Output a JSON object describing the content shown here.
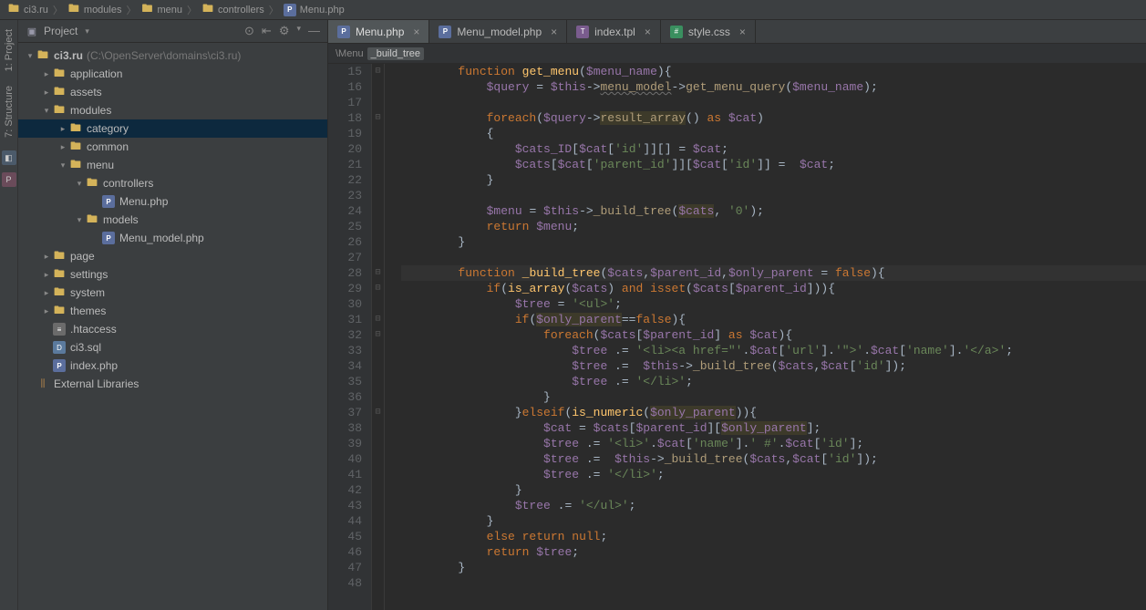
{
  "breadcrumb": [
    {
      "icon": "folder",
      "label": "ci3.ru"
    },
    {
      "icon": "folder",
      "label": "modules"
    },
    {
      "icon": "folder",
      "label": "menu"
    },
    {
      "icon": "folder",
      "label": "controllers"
    },
    {
      "icon": "php",
      "label": "Menu.php"
    }
  ],
  "leftTools": {
    "project": "1: Project",
    "structure": "7: Structure"
  },
  "sidebar": {
    "title": "Project",
    "icons": {
      "locate": "⊙",
      "collapse": "⇤",
      "gear": "⚙",
      "dropdown": "▾",
      "hide": "—"
    }
  },
  "tree": [
    {
      "depth": 0,
      "arrow": "▾",
      "icon": "folder",
      "label": "ci3.ru",
      "extra": "(C:\\OpenServer\\domains\\ci3.ru)",
      "bold": true
    },
    {
      "depth": 1,
      "arrow": "▸",
      "icon": "folder",
      "label": "application"
    },
    {
      "depth": 1,
      "arrow": "▸",
      "icon": "folder",
      "label": "assets"
    },
    {
      "depth": 1,
      "arrow": "▾",
      "icon": "folder",
      "label": "modules"
    },
    {
      "depth": 2,
      "arrow": "▸",
      "icon": "folder",
      "label": "category",
      "selected": true
    },
    {
      "depth": 2,
      "arrow": "▸",
      "icon": "folder",
      "label": "common"
    },
    {
      "depth": 2,
      "arrow": "▾",
      "icon": "folder",
      "label": "menu"
    },
    {
      "depth": 3,
      "arrow": "▾",
      "icon": "folder",
      "label": "controllers"
    },
    {
      "depth": 4,
      "arrow": "",
      "icon": "php",
      "label": "Menu.php"
    },
    {
      "depth": 3,
      "arrow": "▾",
      "icon": "folder",
      "label": "models"
    },
    {
      "depth": 4,
      "arrow": "",
      "icon": "php",
      "label": "Menu_model.php"
    },
    {
      "depth": 1,
      "arrow": "▸",
      "icon": "folder",
      "label": "page"
    },
    {
      "depth": 1,
      "arrow": "▸",
      "icon": "folder",
      "label": "settings"
    },
    {
      "depth": 1,
      "arrow": "▸",
      "icon": "folder",
      "label": "system"
    },
    {
      "depth": 1,
      "arrow": "▸",
      "icon": "folder",
      "label": "themes"
    },
    {
      "depth": 1,
      "arrow": "",
      "icon": "txt",
      "label": ".htaccess"
    },
    {
      "depth": 1,
      "arrow": "",
      "icon": "sql",
      "label": "ci3.sql"
    },
    {
      "depth": 1,
      "arrow": "",
      "icon": "php",
      "label": "index.php"
    },
    {
      "depth": 0,
      "arrow": "",
      "icon": "lib",
      "label": "External Libraries"
    }
  ],
  "tabs": [
    {
      "icon": "php",
      "label": "Menu.php",
      "active": true
    },
    {
      "icon": "php",
      "label": "Menu_model.php"
    },
    {
      "icon": "tpl",
      "label": "index.tpl"
    },
    {
      "icon": "css",
      "label": "style.css"
    }
  ],
  "crumbBar": {
    "c1": "\\Menu",
    "c2": "_build_tree"
  },
  "code": {
    "start": 15,
    "lines": [
      {
        "n": 15,
        "html": "        <span class='c-keyword'>function</span> <span class='c-func'>get_menu</span>(<span class='c-var'>$menu_name</span>){"
      },
      {
        "n": 16,
        "html": "            <span class='c-var'>$query</span> = <span class='c-var'>$this</span>-&gt;<span class='c-method c-underline'>menu_model</span>-&gt;<span class='c-method'>get_menu_query</span>(<span class='c-var'>$menu_name</span>);"
      },
      {
        "n": 17,
        "html": ""
      },
      {
        "n": 18,
        "html": "            <span class='c-keyword'>foreach</span>(<span class='c-var'>$query</span>-&gt;<span class='c-method c-warn'>result_array</span>() <span class='c-keyword'>as</span> <span class='c-var'>$cat</span>)"
      },
      {
        "n": 19,
        "html": "            {"
      },
      {
        "n": 20,
        "html": "                <span class='c-var'>$cats_ID</span>[<span class='c-var'>$cat</span>[<span class='c-string'>'id'</span>]][] = <span class='c-var'>$cat</span>;"
      },
      {
        "n": 21,
        "html": "                <span class='c-var'>$cats</span>[<span class='c-var'>$cat</span>[<span class='c-string'>'parent_id'</span>]][<span class='c-var'>$cat</span>[<span class='c-string'>'id'</span>]] =  <span class='c-var'>$cat</span>;"
      },
      {
        "n": 22,
        "html": "            }"
      },
      {
        "n": 23,
        "html": ""
      },
      {
        "n": 24,
        "html": "            <span class='c-var'>$menu</span> = <span class='c-var'>$this</span>-&gt;<span class='c-method'>_build_tree</span>(<span class='c-var c-warn'>$cats</span>, <span class='c-string'>'0'</span>);"
      },
      {
        "n": 25,
        "html": "            <span class='c-keyword'>return</span> <span class='c-var'>$menu</span>;"
      },
      {
        "n": 26,
        "html": "        }"
      },
      {
        "n": 27,
        "html": ""
      },
      {
        "n": 28,
        "html": "        <span class='c-keyword'>function</span> <span class='c-func'>_build_tree</span>(<span class='c-var'>$cats</span>,<span class='c-var'>$parent_id</span>,<span class='c-var'>$only_parent</span> = <span class='c-keyword'>false</span>){",
        "hl": true
      },
      {
        "n": 29,
        "html": "            <span class='c-keyword'>if</span>(<span class='c-func'>is_array</span>(<span class='c-var'>$cats</span>) <span class='c-keyword'>and</span> <span class='c-keyword'>isset</span>(<span class='c-var'>$cats</span>[<span class='c-var'>$parent_id</span>])){"
      },
      {
        "n": 30,
        "html": "                <span class='c-var'>$tree</span> = <span class='c-string'>'&lt;ul&gt;'</span>;"
      },
      {
        "n": 31,
        "html": "                <span class='c-keyword'>if</span>(<span class='c-var c-warn'>$only_parent</span>==<span class='c-keyword'>false</span>){"
      },
      {
        "n": 32,
        "html": "                    <span class='c-keyword'>foreach</span>(<span class='c-var'>$cats</span>[<span class='c-var'>$parent_id</span>] <span class='c-keyword'>as</span> <span class='c-var'>$cat</span>){"
      },
      {
        "n": 33,
        "html": "                        <span class='c-var'>$tree</span> .= <span class='c-string'>'&lt;li&gt;&lt;a href=\"'</span>.<span class='c-var'>$cat</span>[<span class='c-string'>'url'</span>].<span class='c-string'>'\"&gt;'</span>.<span class='c-var'>$cat</span>[<span class='c-string'>'name'</span>].<span class='c-string'>'&lt;/a&gt;'</span>;"
      },
      {
        "n": 34,
        "html": "                        <span class='c-var'>$tree</span> .=  <span class='c-var'>$this</span>-&gt;<span class='c-method'>_build_tree</span>(<span class='c-var'>$cats</span>,<span class='c-var'>$cat</span>[<span class='c-string'>'id'</span>]);"
      },
      {
        "n": 35,
        "html": "                        <span class='c-var'>$tree</span> .= <span class='c-string'>'&lt;/li&gt;'</span>;"
      },
      {
        "n": 36,
        "html": "                    }"
      },
      {
        "n": 37,
        "html": "                }<span class='c-keyword'>elseif</span>(<span class='c-func'>is_numeric</span>(<span class='c-var c-warn'>$only_parent</span>)){"
      },
      {
        "n": 38,
        "html": "                    <span class='c-var'>$cat</span> = <span class='c-var'>$cats</span>[<span class='c-var'>$parent_id</span>][<span class='c-var c-warn'>$only_parent</span>];"
      },
      {
        "n": 39,
        "html": "                    <span class='c-var'>$tree</span> .= <span class='c-string'>'&lt;li&gt;'</span>.<span class='c-var'>$cat</span>[<span class='c-string'>'name'</span>].<span class='c-string'>' #'</span>.<span class='c-var'>$cat</span>[<span class='c-string'>'id'</span>];"
      },
      {
        "n": 40,
        "html": "                    <span class='c-var'>$tree</span> .=  <span class='c-var'>$this</span>-&gt;<span class='c-method'>_build_tree</span>(<span class='c-var'>$cats</span>,<span class='c-var'>$cat</span>[<span class='c-string'>'id'</span>]);"
      },
      {
        "n": 41,
        "html": "                    <span class='c-var'>$tree</span> .= <span class='c-string'>'&lt;/li&gt;'</span>;"
      },
      {
        "n": 42,
        "html": "                }"
      },
      {
        "n": 43,
        "html": "                <span class='c-var'>$tree</span> .= <span class='c-string'>'&lt;/ul&gt;'</span>;"
      },
      {
        "n": 44,
        "html": "            }"
      },
      {
        "n": 45,
        "html": "            <span class='c-keyword'>else return</span> <span class='c-keyword'>null</span>;"
      },
      {
        "n": 46,
        "html": "            <span class='c-keyword'>return</span> <span class='c-var'>$tree</span>;"
      },
      {
        "n": 47,
        "html": "        }"
      },
      {
        "n": 48,
        "html": ""
      }
    ]
  }
}
